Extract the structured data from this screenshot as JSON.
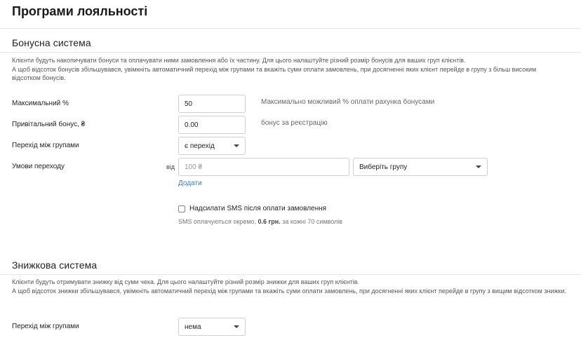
{
  "page_title": "Програми лояльності",
  "bonus": {
    "title": "Бонусна система",
    "desc_line1": "Клієнти будуть накопичувати бонуси та оплачувати ними замовлення або їх частину. Для цього налаштуйте різний розмір бонусів для ваших груп клієнтів.",
    "desc_line2": "А щоб відсоток бонусів збільшувався, увімкніть автоматичний перехід між групами та вкажіть суми оплати замовлень, при досягненні яких клієнт перейде в групу з більш високим відсотком бонусів.",
    "max_percent": {
      "label": "Максимальний %",
      "value": "50",
      "hint": "Максимально можливий % оплати рахунка бонусами"
    },
    "welcome_bonus": {
      "label": "Привітальний бонус, ₴",
      "value": "0.00",
      "hint": "бонус за реєстрацію"
    },
    "group_transition": {
      "label": "Перехід між групами",
      "selected": "є перехід"
    },
    "conditions": {
      "label": "Умови переходу",
      "from_label": "від",
      "amount_placeholder": "100 ₴",
      "group_selected": "Виберіть групу",
      "add_label": "Додати"
    },
    "sms": {
      "checkbox_label": "Надсилати SMS після оплати замовлення",
      "note_prefix": "SMS оплачуються окремо,",
      "note_price": "0.6 грн.",
      "note_suffix": "за кожні 70 символів"
    }
  },
  "discount": {
    "title": "Знижкова система",
    "desc_line1": "Клієнти будуть отримувати знижку від суми чека. Для цього налаштуйте різний розмір знижки для ваших груп клієнтів.",
    "desc_line2": "А щоб відсоток знижки збільшувався, увімкніть автоматичний перехід між групами та вкажіть суми оплати замовлень, при досягненні яких клієнт перейде в групу з вищим відсотком знижки.",
    "group_transition": {
      "label": "Перехід між групами",
      "selected": "нема"
    }
  }
}
